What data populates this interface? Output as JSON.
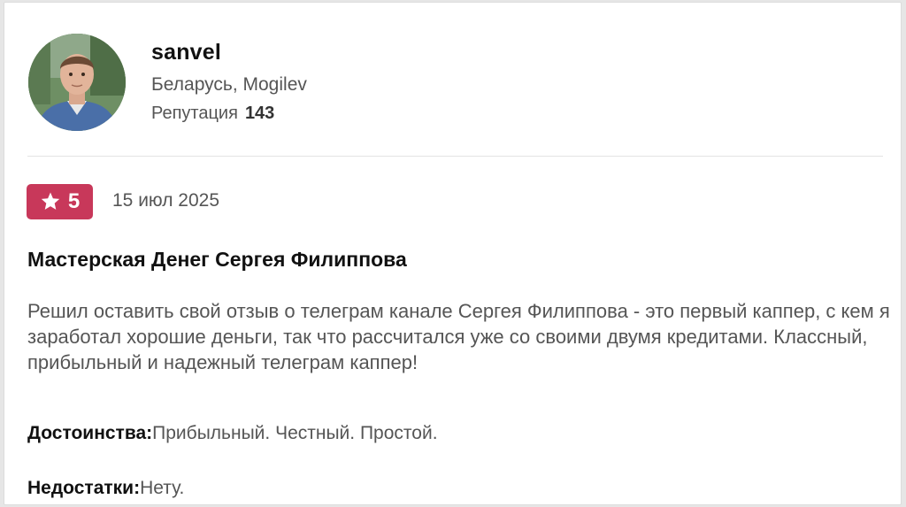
{
  "user": {
    "name": "sanvel",
    "location": "Беларусь, Mogilev",
    "reputation_label": "Репутация",
    "reputation_value": "143",
    "avatar_icon": "user-photo"
  },
  "review": {
    "rating": "5",
    "rating_icon": "star-icon",
    "rating_color": "#c8385a",
    "date": "15 июл 2025",
    "title": "Мастерская Денег Сергея Филиппова",
    "text": "Решил оставить свой отзыв о телеграм канале Сергея Филиппова - это первый каппер, с кем я заработал хорошие деньги, так что рассчитался уже со своими двумя кредитами. Классный, прибыльный и надежный телеграм каппер!",
    "pros_label": "Достоинства:",
    "pros_value": "Прибыльный. Честный. Простой.",
    "cons_label": "Недостатки:",
    "cons_value": "Нету."
  }
}
